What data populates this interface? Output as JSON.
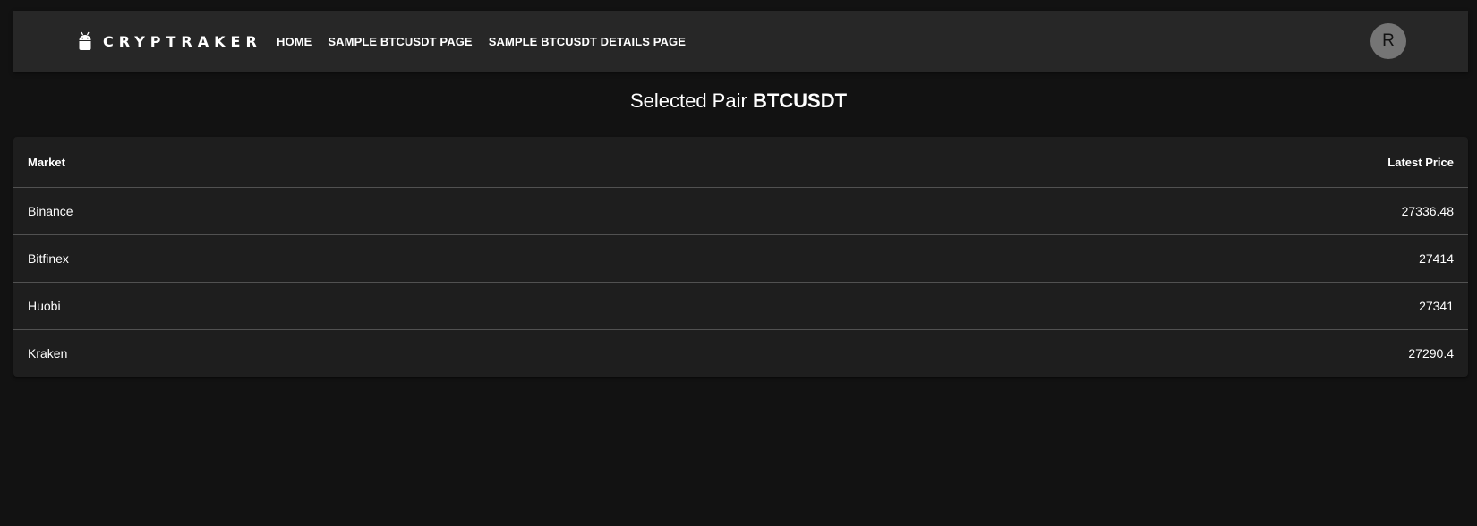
{
  "header": {
    "brand": "CRYPTRAKER",
    "brand_icon": "android-robot-icon",
    "nav": [
      {
        "label": "HOME"
      },
      {
        "label": "SAMPLE BTCUSDT PAGE"
      },
      {
        "label": "SAMPLE BTCUSDT DETAILS PAGE"
      }
    ],
    "avatar_initial": "R"
  },
  "main": {
    "heading_prefix": "Selected Pair",
    "pair": "BTCUSDT",
    "table": {
      "columns": [
        "Market",
        "Latest Price"
      ],
      "rows": [
        {
          "market": "Binance",
          "price": "27336.48"
        },
        {
          "market": "Bitfinex",
          "price": "27414"
        },
        {
          "market": "Huobi",
          "price": "27341"
        },
        {
          "market": "Kraken",
          "price": "27290.4"
        }
      ]
    }
  },
  "colors": {
    "background": "#121212",
    "appbar": "#272727",
    "card": "#1e1e1e",
    "divider": "#515151",
    "avatar": "#757575",
    "text": "#ffffff"
  }
}
